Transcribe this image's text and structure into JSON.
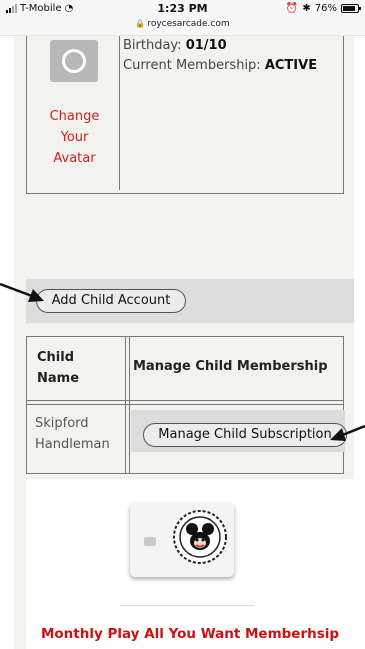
{
  "status_bar": {
    "carrier": "T-Mobile",
    "time": "1:23 PM",
    "url": "roycesarcade.com",
    "battery": "76%"
  },
  "profile": {
    "birthday_label": "Birthday:",
    "birthday_value": "01/10",
    "membership_label": "Current Membership:",
    "membership_value": "ACTIVE",
    "change_avatar_line1": "Change",
    "change_avatar_line2": "Your",
    "change_avatar_line3": "Avatar"
  },
  "add_child": {
    "button_label": "Add Child Account"
  },
  "child_table": {
    "headers": {
      "name_line1": "Child",
      "name_line2": "Name",
      "manage": "Manage Child Membership"
    },
    "rows": [
      {
        "name_line1": "Skipford",
        "name_line2": "Handleman",
        "button_label": "Manage Child Subscription"
      }
    ]
  },
  "membership": {
    "title": "Monthly Play All You Want Memberhsip"
  },
  "colors": {
    "accent_red": "#cc1111",
    "page_bg": "#f2f2ef",
    "button_bar": "#dedddd"
  }
}
